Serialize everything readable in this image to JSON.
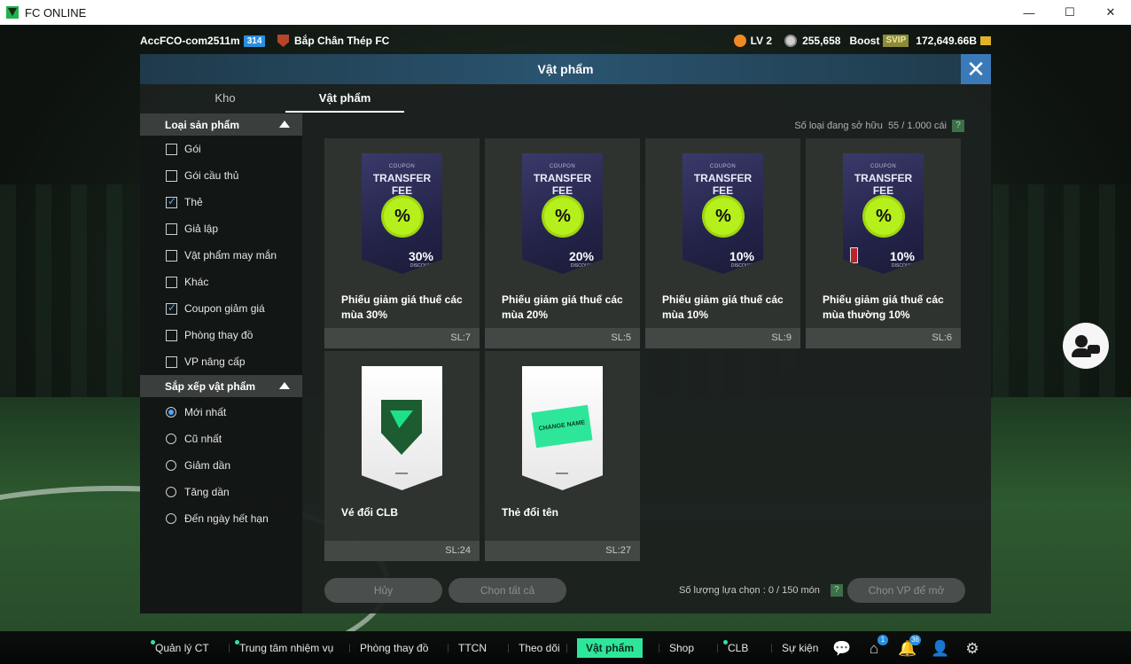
{
  "window": {
    "title": "FC ONLINE",
    "minimize": "—",
    "maximize": "☐",
    "close": "✕"
  },
  "topbar": {
    "account": "AccFCO-com2511m",
    "account_level": "314",
    "club": "Bắp Chân Thép FC",
    "level": "LV 2",
    "trophies": "255,658",
    "boost_label": "Boost",
    "svip": "SVIP",
    "coins": "172,649.66B"
  },
  "dialog": {
    "title": "Vật phẩm",
    "close": "✕",
    "tabs": [
      "Kho",
      "Vật phẩm"
    ]
  },
  "sidebar": {
    "filter_header": "Loại sản phẩm",
    "filters": [
      {
        "label": "Gói",
        "checked": false
      },
      {
        "label": "Gói cầu thủ",
        "checked": false
      },
      {
        "label": "Thẻ",
        "checked": true
      },
      {
        "label": "Giả lập",
        "checked": false
      },
      {
        "label": "Vật phẩm may mắn",
        "checked": false
      },
      {
        "label": "Khác",
        "checked": false
      },
      {
        "label": "Coupon giảm giá",
        "checked": true
      },
      {
        "label": "Phòng thay đồ",
        "checked": false
      },
      {
        "label": "VP nâng cấp",
        "checked": false
      }
    ],
    "sort_header": "Sắp xếp vật phẩm",
    "sorts": [
      {
        "label": "Mới nhất",
        "checked": true
      },
      {
        "label": "Cũ nhất",
        "checked": false
      },
      {
        "label": "Giảm dần",
        "checked": false
      },
      {
        "label": "Tăng dần",
        "checked": false
      },
      {
        "label": "Đến ngày hết hạn",
        "checked": false
      }
    ]
  },
  "content": {
    "owned_label": "Số loại đang sở hữu",
    "owned_value": "55 / 1.000 cái",
    "help": "?",
    "items": [
      {
        "name": "Phiếu giảm giá thuế các mùa 30%",
        "qty": "SL:7",
        "kind": "coupon",
        "small": "COUPON",
        "title": "TRANSFER FEE",
        "pct": "30%",
        "disc": "DISCOUNT"
      },
      {
        "name": "Phiếu giảm giá thuế các mùa 20%",
        "qty": "SL:5",
        "kind": "coupon",
        "small": "COUPON",
        "title": "TRANSFER FEE",
        "pct": "20%",
        "disc": "DISCOUNT"
      },
      {
        "name": "Phiếu giảm giá thuế các mùa 10%",
        "qty": "SL:9",
        "kind": "coupon",
        "small": "COUPON",
        "title": "TRANSFER FEE",
        "pct": "10%",
        "disc": "DISCOUNT"
      },
      {
        "name": "Phiếu giảm giá thuế các mùa thường 10%",
        "qty": "SL:6",
        "kind": "coupon",
        "small": "COUPON",
        "title": "TRANSFER FEE",
        "pct": "10%",
        "disc": "DISCOUNT"
      },
      {
        "name": "Vé đổi CLB",
        "qty": "SL:24",
        "kind": "club"
      },
      {
        "name": "Thẻ đổi tên",
        "qty": "SL:27",
        "kind": "rename",
        "ticket_text": "CHANGE NAME"
      }
    ],
    "badge_symbol": "%",
    "cancel_label": "Hủy",
    "select_all_label": "Chọn tất cả",
    "selected_count": "Số lượng lựa chọn : 0 / 150 món",
    "open_label": "Chọn VP để mở"
  },
  "nav": {
    "items": [
      {
        "label": "Quản lý CT",
        "dot": true
      },
      {
        "label": "Trung tâm nhiệm vụ",
        "dot": true
      },
      {
        "label": "Phòng thay đồ",
        "dot": false
      },
      {
        "label": "TTCN",
        "dot": false
      },
      {
        "label": "Theo dõi",
        "dot": false
      },
      {
        "label": "Vật phẩm",
        "dot": false,
        "active": true
      },
      {
        "label": "Shop",
        "dot": false
      },
      {
        "label": "CLB",
        "dot": true
      },
      {
        "label": "Sự kiện",
        "dot": false
      }
    ],
    "icons": [
      {
        "name": "chat-icon",
        "badge": ""
      },
      {
        "name": "home-icon",
        "badge": "1"
      },
      {
        "name": "bell-icon",
        "badge": "36"
      },
      {
        "name": "profile-icon",
        "badge": ""
      },
      {
        "name": "settings-icon",
        "badge": ""
      }
    ]
  }
}
